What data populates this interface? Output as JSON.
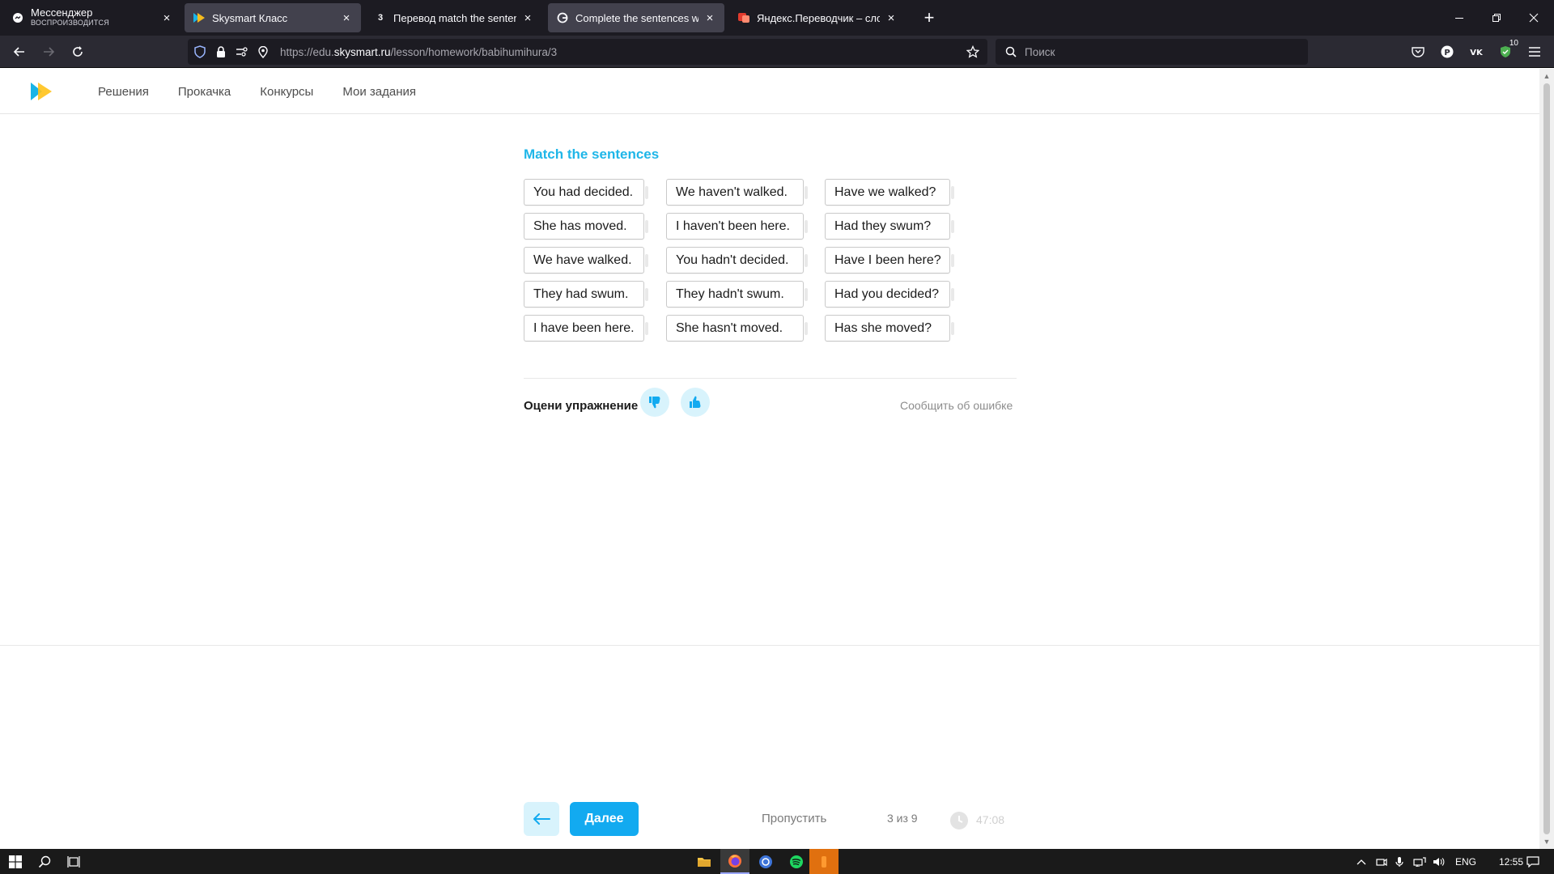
{
  "browser": {
    "tabs": [
      {
        "title": "Мессенджер",
        "subtitle": "ВОСПРОИЗВОДИТСЯ",
        "active": false
      },
      {
        "title": "Skysmart Класс",
        "active": true
      },
      {
        "title": "Перевод match the sentences",
        "active": false
      },
      {
        "title": "Complete the sentences with t",
        "active": true
      },
      {
        "title": "Яндекс.Переводчик – словарь",
        "active": false
      }
    ],
    "url_prefix": "https://edu.",
    "url_host": "skysmart.ru",
    "url_path": "/lesson/homework/babihumihura/3",
    "search_placeholder": "Поиск",
    "extension_badge": "10"
  },
  "site": {
    "nav": [
      "Решения",
      "Прокачка",
      "Конкурсы",
      "Мои задания"
    ],
    "accent_color": "#1fb6e8",
    "button_color": "#12aaf0"
  },
  "exercise": {
    "title": "Match the sentences",
    "columns": [
      [
        "You had decided.",
        "She has moved.",
        "We have walked.",
        "They had swum.",
        "I have been here."
      ],
      [
        "We haven't walked.",
        "I haven't been here.",
        "You hadn't decided.",
        "They hadn't swum.",
        "She hasn't moved."
      ],
      [
        "Have we walked?",
        "Had they swum?",
        "Have I been here?",
        "Had you decided?",
        "Has she moved?"
      ]
    ],
    "rate_label": "Оцени упражнение",
    "report_label": "Сообщить об ошибке"
  },
  "footer": {
    "next_label": "Далее",
    "skip_label": "Пропустить",
    "progress": "3 из 9",
    "timer": "47:08"
  },
  "taskbar": {
    "language": "ENG",
    "clock": "12:55"
  }
}
